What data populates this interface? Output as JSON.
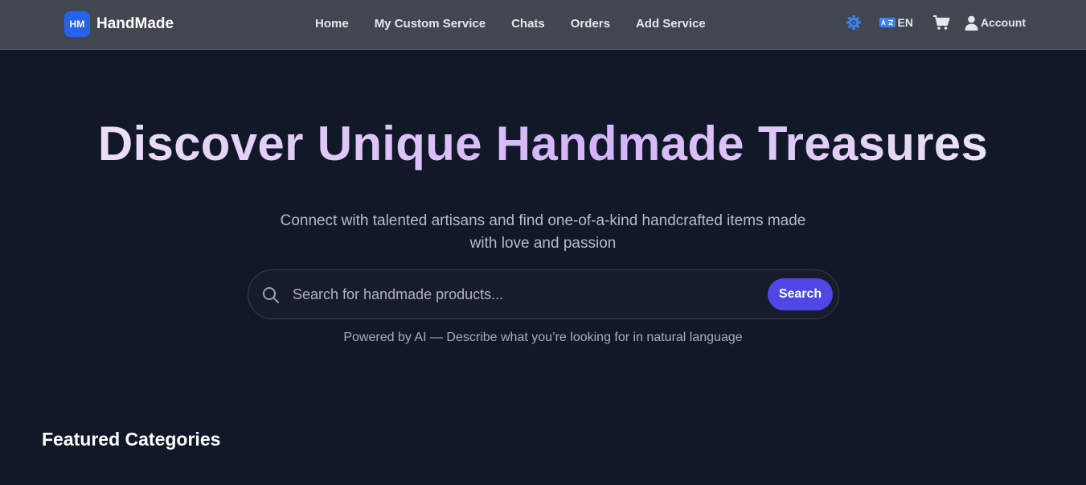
{
  "brand": {
    "logo_text": "HM",
    "name": "HandMade"
  },
  "nav": {
    "links": [
      {
        "label": "Home"
      },
      {
        "label": "My Custom Service"
      },
      {
        "label": "Chats"
      },
      {
        "label": "Orders"
      },
      {
        "label": "Add Service"
      }
    ]
  },
  "header_right": {
    "settings_icon": "gear-icon",
    "language_icon": "language-icon",
    "language_label": "EN",
    "cart_icon": "cart-icon",
    "account_icon": "user-icon",
    "account_label": "Account"
  },
  "hero": {
    "title": "Discover Unique Handmade Treasures",
    "subtitle": "Connect with talented artisans and find one-of-a-kind handcrafted items made with love and passion"
  },
  "search": {
    "placeholder": "Search for handmade products...",
    "value": "",
    "button_label": "Search",
    "hint": "Powered by AI — Describe what you’re looking for in natural language"
  },
  "featured": {
    "title": "Featured Categories"
  },
  "colors": {
    "navbar_bg": "#424651",
    "page_bg": "#111827",
    "brand_accent": "#2563eb",
    "search_button": "#4f46e5",
    "settings_icon": "#3b82f6",
    "title_gradient": [
      "#f1eaf9",
      "#d4b3fa",
      "#f4eef9"
    ]
  }
}
